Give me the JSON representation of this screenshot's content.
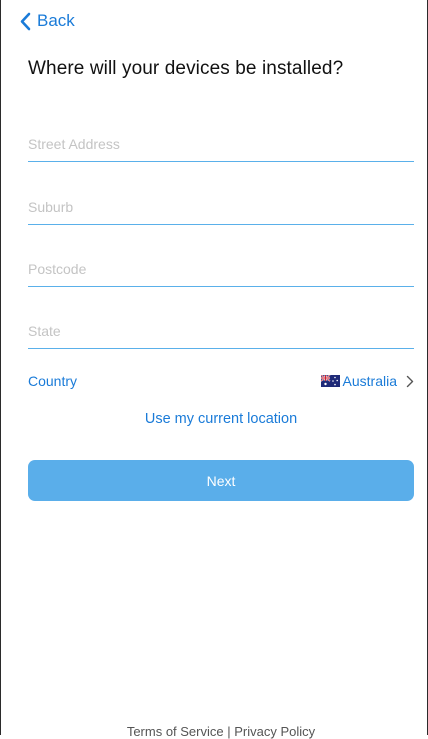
{
  "nav": {
    "back_label": "Back"
  },
  "page": {
    "title": "Where will your devices be installed?"
  },
  "form": {
    "street_placeholder": "Street Address",
    "street_value": "",
    "suburb_placeholder": "Suburb",
    "suburb_value": "",
    "postcode_placeholder": "Postcode",
    "postcode_value": "",
    "state_placeholder": "State",
    "state_value": "",
    "country_label": "Country",
    "country_value": "Australia",
    "country_flag_icon": "australia-flag-icon"
  },
  "actions": {
    "use_location_label": "Use my current location",
    "next_label": "Next"
  },
  "footer": {
    "terms_label": "Terms of Service",
    "separator": "|",
    "privacy_label": "Privacy Policy"
  },
  "colors": {
    "accent": "#1a7bd8",
    "button_bg": "#5aaeea",
    "field_underline": "#5ab0ea",
    "placeholder": "#c4c4c4"
  }
}
